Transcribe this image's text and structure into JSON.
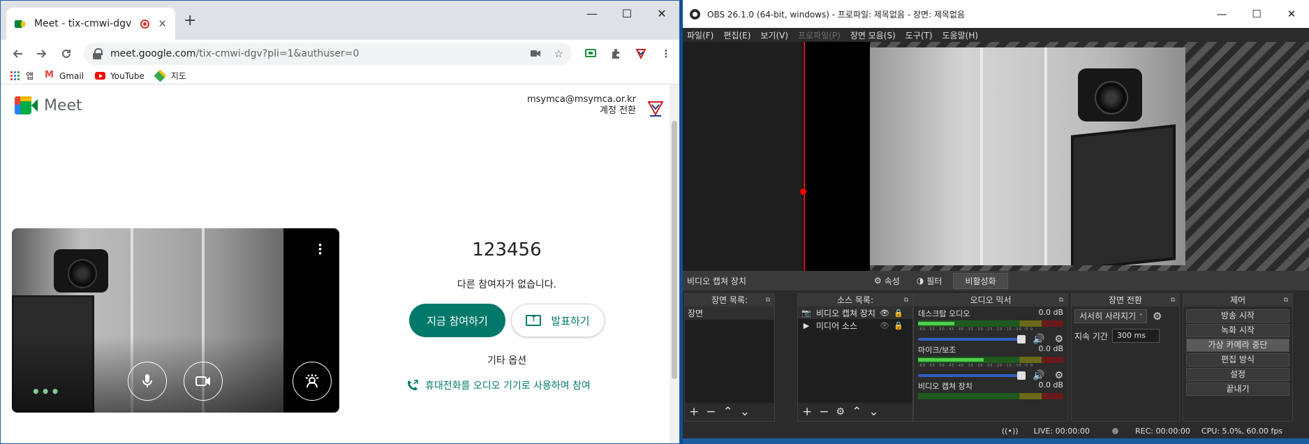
{
  "chrome": {
    "tab_title": "Meet - tix-cmwi-dgv",
    "tab_close": "✕",
    "new_tab": "+",
    "win_minimize": "—",
    "win_maximize": "☐",
    "win_close": "✕",
    "url_domain": "meet.google.com",
    "url_rest": "/tix-cmwi-dgv?pli=1&authuser=0",
    "bookmarks": [
      {
        "label": "앱"
      },
      {
        "label": "Gmail"
      },
      {
        "label": "YouTube"
      },
      {
        "label": "지도"
      }
    ]
  },
  "meet": {
    "logo_text": "Meet",
    "account_email": "msymca@msymca.or.kr",
    "switch_account": "계정 전환",
    "meeting_code": "123456",
    "no_others": "다른 참여자가 없습니다.",
    "join_now": "지금 참여하기",
    "present": "발표하기",
    "other_options": "기타 옵션",
    "phone_audio": "휴대전화를 오디오 기기로 사용하여 참여"
  },
  "obs": {
    "title": "OBS 26.1.0 (64-bit, windows) - 프로파일: 제목없음 - 장면: 제목없음",
    "win_minimize": "—",
    "win_maximize": "☐",
    "win_close": "✕",
    "menu": [
      "파일(F)",
      "편집(E)",
      "보기(V)",
      "프로파일(P)",
      "장면 모음(S)",
      "도구(T)",
      "도움말(H)"
    ],
    "selected_source": "비디오 캡쳐 장치",
    "properties": "속성",
    "filters": "필터",
    "deactivate": "비활성화",
    "docks": {
      "scenes": {
        "title": "장면 목록:",
        "items": [
          "장면"
        ]
      },
      "sources": {
        "title": "소스 목록:",
        "items": [
          "비디오 캡쳐 장치",
          "미디어 소스"
        ]
      },
      "mixer": {
        "title": "오디오 믹서",
        "channels": [
          {
            "name": "데스크탑 오디오",
            "db": "0.0 dB",
            "level": 0.25
          },
          {
            "name": "마이크/보조",
            "db": "0.0 dB",
            "level": 0.45
          },
          {
            "name": "비디오 캡쳐 장치",
            "db": "0.0 dB",
            "level": 0.0
          }
        ],
        "ticks": "-60 -55 -50 -45 -40 -35 -30 -25 -20 -15 -10 -5 0"
      },
      "transitions": {
        "title": "장면 전환",
        "selected": "서서히 사라지기",
        "duration_label": "지속 기간",
        "duration": "300 ms"
      },
      "controls": {
        "title": "제어",
        "buttons": [
          "방송 시작",
          "녹화 시작",
          "가상 카메라 중단",
          "편집 방식",
          "설정",
          "끝내기"
        ]
      }
    },
    "status": {
      "live": "LIVE: 00:00:00",
      "rec": "REC: 00:00:00",
      "cpu": "CPU: 5.0%, 60.00 fps"
    }
  }
}
